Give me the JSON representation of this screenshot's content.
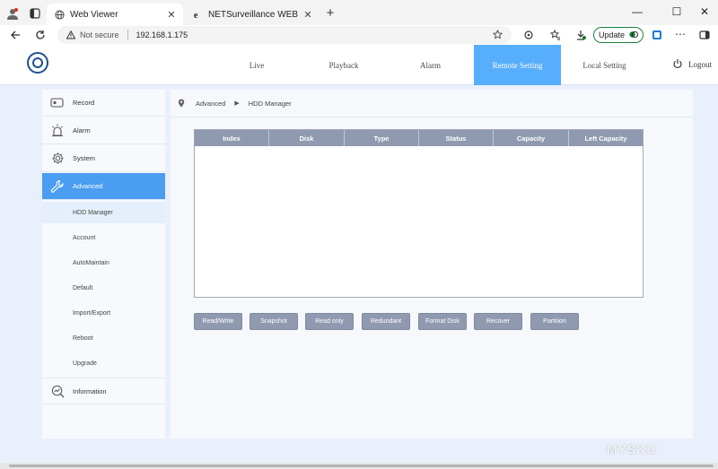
{
  "browser": {
    "tabs": [
      {
        "title": "Web Viewer",
        "active": true
      },
      {
        "title": "NETSurveillance WEB",
        "active": false
      }
    ],
    "new_tab": "+",
    "window_controls": {
      "minimize": "—",
      "maximize": "☐",
      "close": "✕"
    },
    "address": {
      "security": "Not secure",
      "url": "192.168.1.175"
    },
    "update_label": "Update",
    "more": "⋯"
  },
  "nav": {
    "items": [
      {
        "label": "Live",
        "active": false
      },
      {
        "label": "Playback",
        "active": false
      },
      {
        "label": "Alarm",
        "active": false
      },
      {
        "label": "Remote Setting",
        "active": true
      },
      {
        "label": "Local Setting",
        "active": false
      }
    ],
    "logout": "Logout"
  },
  "sidebar": {
    "items": [
      {
        "label": "Record",
        "icon": "record-icon"
      },
      {
        "label": "Alarm",
        "icon": "alarm-icon"
      },
      {
        "label": "System",
        "icon": "gear-icon"
      },
      {
        "label": "Advanced",
        "icon": "wrench-icon",
        "active": true
      }
    ],
    "subitems": [
      {
        "label": "HDD Manager",
        "active": true
      },
      {
        "label": "Account"
      },
      {
        "label": "AutoMaintain"
      },
      {
        "label": "Default"
      },
      {
        "label": "Import/Export"
      },
      {
        "label": "Reboot"
      },
      {
        "label": "Upgrade"
      }
    ],
    "information": {
      "label": "Information",
      "icon": "information-icon"
    }
  },
  "breadcrumb": {
    "parent": "Advanced",
    "current": "HDD Manager"
  },
  "table": {
    "columns": [
      "Index",
      "Disk",
      "Type",
      "Status",
      "Capacity",
      "Left Capacity"
    ],
    "rows": []
  },
  "buttons": [
    "Read/Write",
    "Snapshot",
    "Read only",
    "Redundant",
    "Format Disk",
    "Recover",
    "Partition"
  ],
  "watermark": "MYSKU",
  "colors": {
    "accent": "#56aefc",
    "sidebar_active": "#4a9df0",
    "table_header": "#8f9ab0"
  }
}
